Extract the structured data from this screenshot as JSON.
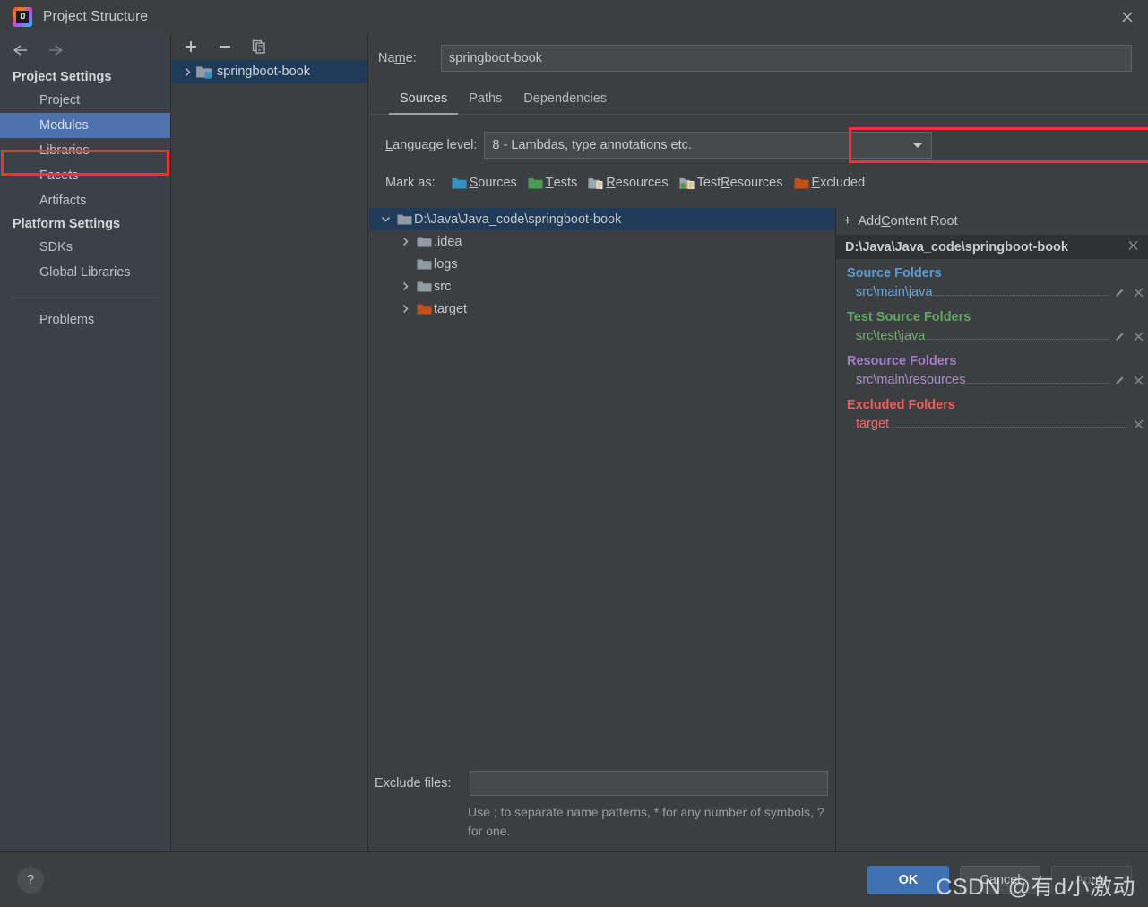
{
  "window": {
    "title": "Project Structure",
    "app_icon": "intellij-idea-icon",
    "close_icon": "close-icon"
  },
  "sidebar": {
    "back_icon": "back-arrow-icon",
    "forward_icon": "forward-arrow-icon",
    "groups": [
      {
        "label": "Project Settings",
        "items": [
          {
            "label": "Project",
            "selected": false
          },
          {
            "label": "Modules",
            "selected": true
          },
          {
            "label": "Libraries",
            "selected": false
          },
          {
            "label": "Facets",
            "selected": false
          },
          {
            "label": "Artifacts",
            "selected": false
          }
        ]
      },
      {
        "label": "Platform Settings",
        "items": [
          {
            "label": "SDKs",
            "selected": false
          },
          {
            "label": "Global Libraries",
            "selected": false
          }
        ]
      }
    ],
    "problems_label": "Problems",
    "highlight_color": "#ff2d2d",
    "selection_color": "#4e72ad"
  },
  "modules_panel": {
    "toolbar": {
      "add_label": "+",
      "remove_label": "−",
      "copy_label": "copy"
    },
    "items": [
      {
        "label": "springboot-book",
        "selected": true
      }
    ]
  },
  "main": {
    "name_label_pre": "Na",
    "name_label_underlined": "m",
    "name_label_post": "e:",
    "name_value": "springboot-book",
    "tabs": [
      {
        "label": "Sources",
        "active": true
      },
      {
        "label": "Paths",
        "active": false
      },
      {
        "label": "Dependencies",
        "active": false
      }
    ],
    "language_level": {
      "label_underlined": "L",
      "label_rest": "anguage level:",
      "value": "8 - Lambdas, type annotations etc.",
      "highlight_color": "#ff2d2d"
    },
    "mark_as": {
      "label": "Mark as:",
      "options": [
        {
          "pre": "",
          "key": "S",
          "post": "ources",
          "icon": "folder-sources-icon",
          "color": "#3592c4"
        },
        {
          "pre": "",
          "key": "T",
          "post": "ests",
          "icon": "folder-tests-icon",
          "color": "#499c54"
        },
        {
          "pre": "",
          "key": "R",
          "post": "esources",
          "icon": "folder-resources-icon",
          "color": "#9aa7b0"
        },
        {
          "pre": "Test ",
          "key": "R",
          "post": "esources",
          "icon": "folder-test-resources-icon",
          "color": "#9aa7b0"
        },
        {
          "pre": "",
          "key": "E",
          "post": "xcluded",
          "icon": "folder-excluded-icon",
          "color": "#c75450"
        }
      ]
    },
    "tree": [
      {
        "label": "D:\\Java\\Java_code\\springboot-book",
        "depth": 0,
        "expanded": true,
        "has_arrow": true,
        "selected": true,
        "icon_color": "#8f9ba6"
      },
      {
        "label": ".idea",
        "depth": 1,
        "expanded": false,
        "has_arrow": true,
        "selected": false,
        "icon_color": "#8f9ba6"
      },
      {
        "label": "logs",
        "depth": 1,
        "expanded": false,
        "has_arrow": false,
        "selected": false,
        "icon_color": "#8f9ba6"
      },
      {
        "label": "src",
        "depth": 1,
        "expanded": false,
        "has_arrow": true,
        "selected": false,
        "icon_color": "#8f9ba6"
      },
      {
        "label": "target",
        "depth": 1,
        "expanded": false,
        "has_arrow": true,
        "selected": false,
        "icon_color": "#c2501b"
      }
    ],
    "exclude_files": {
      "label": "Exclude files:",
      "value": "",
      "hint": "Use ; to separate name patterns, * for any number of symbols, ? for one."
    }
  },
  "roots_panel": {
    "add_content_root": {
      "pre": "Add ",
      "key": "C",
      "post": "ontent Root"
    },
    "content_root": "D:\\Java\\Java_code\\springboot-book",
    "groups": [
      {
        "title": "Source Folders",
        "color": "#5b9bd5",
        "entry_color": "#6aa8de",
        "entries": [
          {
            "path": "src\\main\\java",
            "has_pencil": true
          }
        ]
      },
      {
        "title": "Test Source Folders",
        "color": "#62a862",
        "entry_color": "#74b074",
        "entries": [
          {
            "path": "src\\test\\java",
            "has_pencil": true
          }
        ]
      },
      {
        "title": "Resource Folders",
        "color": "#a67cc4",
        "entry_color": "#b08cc9",
        "entries": [
          {
            "path": "src\\main\\resources",
            "has_pencil": true
          }
        ]
      },
      {
        "title": "Excluded Folders",
        "color": "#f05b5b",
        "entry_color": "#f06a6a",
        "entries": [
          {
            "path": "target",
            "has_pencil": false
          }
        ]
      }
    ]
  },
  "footer": {
    "help_label": "?",
    "ok_label": "OK",
    "cancel_label": "Cancel",
    "apply_label": "Apply"
  },
  "watermark": "CSDN @有d小激动"
}
